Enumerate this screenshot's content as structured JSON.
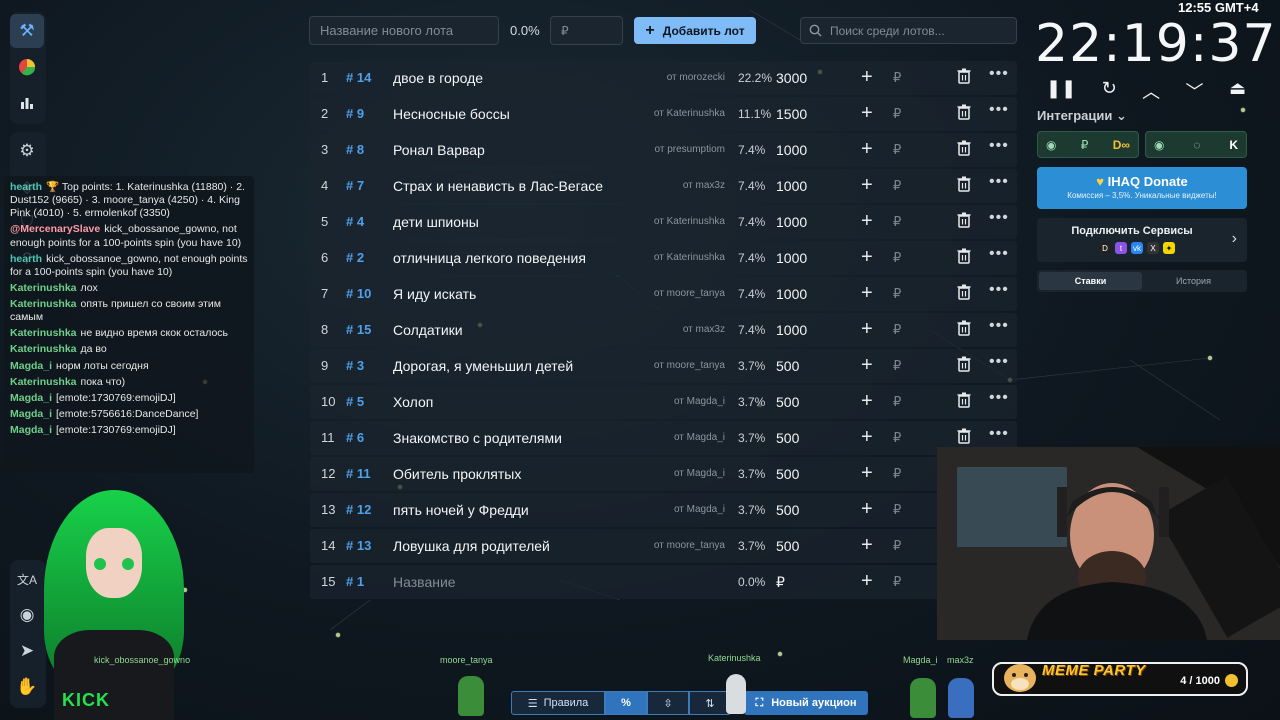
{
  "status_clock": "12:55 GMT+4",
  "rail": {
    "items": [
      "hammer-icon",
      "pie-chart-icon",
      "bar-chart-icon",
      "gear-icon",
      "layers-icon",
      "shield-icon",
      "help-icon",
      "sliders-icon"
    ],
    "bottom_items": [
      "translate-icon",
      "github-icon",
      "telegram-icon",
      "handshake-icon"
    ]
  },
  "chat": [
    {
      "user": "hearth",
      "text": "🏆 Top points: 1. Katerinushka (11880) · 2. Dust152 (9665) · 3. moore_tanya (4250) · 4. King Pink (4010) · 5. ermolenkof (3350)",
      "color": "teal"
    },
    {
      "user": "@MercenarySlave",
      "text": "kick_obossanoe_gowno, not enough points for a 100-points spin (you have 10)",
      "color": "mention"
    },
    {
      "user": "hearth",
      "text": "kick_obossanoe_gowno, not enough points for a 100-points spin (you have 10)",
      "color": "teal"
    },
    {
      "user": "Katerinushka",
      "text": "лох",
      "color": "green"
    },
    {
      "user": "Katerinushka",
      "text": "опять пришел со своим этим самым",
      "color": "green"
    },
    {
      "user": "Katerinushka",
      "text": "не видно время скок осталось",
      "color": "green"
    },
    {
      "user": "Katerinushka",
      "text": "да во",
      "color": "green"
    },
    {
      "user": "Magda_i",
      "text": "норм лоты сегодня",
      "color": "green"
    },
    {
      "user": "Katerinushka",
      "text": "пока что)",
      "color": "green"
    },
    {
      "user": "Magda_i",
      "text": "[emote:1730769:emojiDJ]",
      "color": "green"
    },
    {
      "user": "Magda_i",
      "text": "[emote:5756616:DanceDance]",
      "color": "green"
    },
    {
      "user": "Magda_i",
      "text": "[emote:1730769:emojiDJ]",
      "color": "green"
    }
  ],
  "avatar_caption": "kick_obossanoe_gowno",
  "toolbar": {
    "lot_placeholder": "Название нового лота",
    "percent": "0.0%",
    "currency": "₽",
    "add_label": "Добавить лот",
    "search_placeholder": "Поиск среди лотов..."
  },
  "lots": [
    {
      "idx": "1",
      "num": "# 14",
      "name": "двое в городе",
      "from": "от morozecki",
      "pct": "22.2%",
      "amount": "3000"
    },
    {
      "idx": "2",
      "num": "# 9",
      "name": "Несносные боссы",
      "from": "от Katerinushka",
      "pct": "11.1%",
      "amount": "1500"
    },
    {
      "idx": "3",
      "num": "# 8",
      "name": "Ронал Варвар",
      "from": "от presumptiom",
      "pct": "7.4%",
      "amount": "1000"
    },
    {
      "idx": "4",
      "num": "# 7",
      "name": "Страх и ненависть в Лас-Вегасе",
      "from": "от max3z",
      "pct": "7.4%",
      "amount": "1000"
    },
    {
      "idx": "5",
      "num": "# 4",
      "name": "дети шпионы",
      "from": "от Katerinushka",
      "pct": "7.4%",
      "amount": "1000"
    },
    {
      "idx": "6",
      "num": "# 2",
      "name": "отличница легкого поведения",
      "from": "от Katerinushka",
      "pct": "7.4%",
      "amount": "1000"
    },
    {
      "idx": "7",
      "num": "# 10",
      "name": "Я иду искать",
      "from": "от moore_tanya",
      "pct": "7.4%",
      "amount": "1000"
    },
    {
      "idx": "8",
      "num": "# 15",
      "name": "Солдатики",
      "from": "от max3z",
      "pct": "7.4%",
      "amount": "1000"
    },
    {
      "idx": "9",
      "num": "# 3",
      "name": "Дорогая, я уменьшил детей",
      "from": "от moore_tanya",
      "pct": "3.7%",
      "amount": "500"
    },
    {
      "idx": "10",
      "num": "# 5",
      "name": "Холоп",
      "from": "от Magda_i",
      "pct": "3.7%",
      "amount": "500"
    },
    {
      "idx": "11",
      "num": "# 6",
      "name": "Знакомство с родителями",
      "from": "от Magda_i",
      "pct": "3.7%",
      "amount": "500"
    },
    {
      "idx": "12",
      "num": "# 11",
      "name": "Обитель проклятых",
      "from": "от Magda_i",
      "pct": "3.7%",
      "amount": "500"
    },
    {
      "idx": "13",
      "num": "# 12",
      "name": "пять ночей у Фредди",
      "from": "от Magda_i",
      "pct": "3.7%",
      "amount": "500"
    },
    {
      "idx": "14",
      "num": "# 13",
      "name": "Ловушка для родителей",
      "from": "от moore_tanya",
      "pct": "3.7%",
      "amount": "500"
    },
    {
      "idx": "15",
      "num": "# 1",
      "name": "Название",
      "from": "",
      "pct": "0.0%",
      "amount": "₽",
      "placeholder": true
    }
  ],
  "timer": "22:19:37",
  "integrations": {
    "label": "Интеграции",
    "cards": [
      {
        "left": "₽",
        "right": "D∞"
      },
      {
        "left": "◌",
        "right": "K"
      }
    ]
  },
  "donate": {
    "title": "IHAQ Donate",
    "subtitle": "Комиссия – 3,5%. Уникальные виджеты!"
  },
  "services": {
    "title": "Подключить Сервисы"
  },
  "tabs": [
    "Ставки",
    "История"
  ],
  "meme": {
    "title": "MEME PARTY",
    "count": "4 / 1000"
  },
  "bottom": {
    "rules_label": "Правила",
    "new_auction_label": "Новый аукцион"
  },
  "bots": [
    "moore_tanya",
    "Katerinushka",
    "Magda_i",
    "max3z"
  ],
  "colors": {
    "accent": "#4fa0ea",
    "add_button": "#7fbcf7",
    "donate": "#2c8fd6",
    "meme": "#ffc531"
  }
}
